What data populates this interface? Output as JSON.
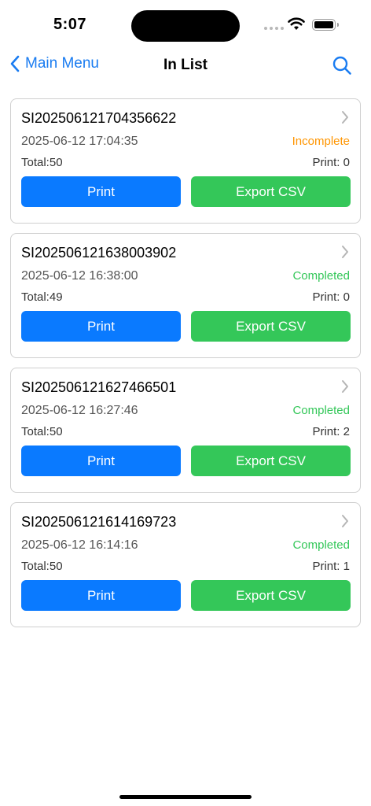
{
  "status_bar": {
    "time": "5:07"
  },
  "nav": {
    "back_label": "Main Menu",
    "title": "In List"
  },
  "colors": {
    "accent": "#1a7cf1",
    "print_button": "#0a7aff",
    "export_button": "#34c759",
    "incomplete": "#ff9500",
    "completed": "#34c759"
  },
  "records": [
    {
      "id": "SI202506121704356622",
      "date": "2025-06-12 17:04:35",
      "status": "Incomplete",
      "status_color": "#ff9500",
      "total": "Total:50",
      "print": "Print: 0",
      "print_label": "Print",
      "export_label": "Export CSV"
    },
    {
      "id": "SI202506121638003902",
      "date": "2025-06-12 16:38:00",
      "status": "Completed",
      "status_color": "#34c759",
      "total": "Total:49",
      "print": "Print: 0",
      "print_label": "Print",
      "export_label": "Export CSV"
    },
    {
      "id": "SI202506121627466501",
      "date": "2025-06-12 16:27:46",
      "status": "Completed",
      "status_color": "#34c759",
      "total": "Total:50",
      "print": "Print: 2",
      "print_label": "Print",
      "export_label": "Export CSV"
    },
    {
      "id": "SI202506121614169723",
      "date": "2025-06-12 16:14:16",
      "status": "Completed",
      "status_color": "#34c759",
      "total": "Total:50",
      "print": "Print: 1",
      "print_label": "Print",
      "export_label": "Export CSV"
    }
  ]
}
